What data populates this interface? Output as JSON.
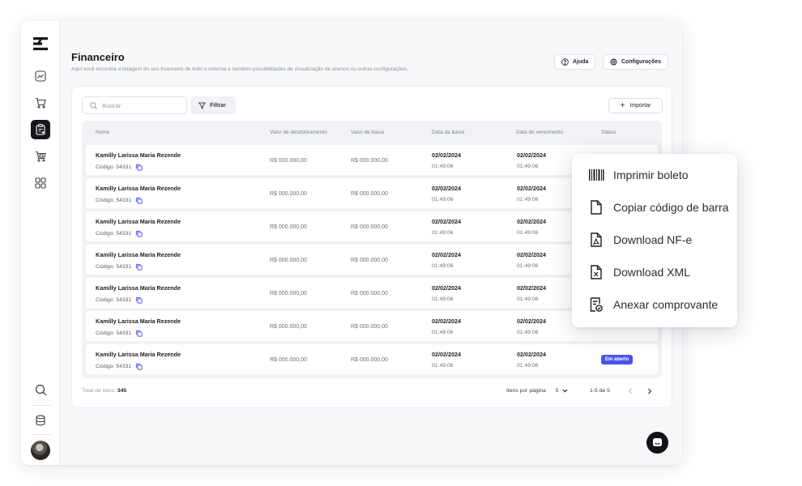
{
  "header": {
    "title": "Financeiro",
    "subtitle": "Aqui você encontra a listagem do seu financeiro de todo o sistema e também possibilidades de visualização de anexos ou outras configurações.",
    "help_label": "Ajuda",
    "settings_label": "Configurações"
  },
  "toolbar": {
    "search_placeholder": "Buscar",
    "filter_label": "Filtrar",
    "import_label": "Importar"
  },
  "table": {
    "columns": [
      "Nome",
      "Valor de desdobramento",
      "Valor de baixa",
      "Data da baixa",
      "Data do vencimento",
      "Status"
    ],
    "rows": [
      {
        "name": "Kamilly Larissa Maria Rezende",
        "code": "Código: 54331",
        "split_value": "R$ 000.000,00",
        "paid_value": "R$ 000.000,00",
        "paid_date": "02/02/2024",
        "paid_time": "01:49:06",
        "due_date": "02/02/2024",
        "due_time": "01:49:06",
        "status": ""
      },
      {
        "name": "Kamilly Larissa Maria Rezende",
        "code": "Código: 54331",
        "split_value": "R$ 000.000,00",
        "paid_value": "R$ 000.000,00",
        "paid_date": "02/02/2024",
        "paid_time": "01:49:06",
        "due_date": "02/02/2024",
        "due_time": "01:49:06",
        "status": ""
      },
      {
        "name": "Kamilly Larissa Maria Rezende",
        "code": "Código: 54331",
        "split_value": "R$ 000.000,00",
        "paid_value": "R$ 000.000,00",
        "paid_date": "02/02/2024",
        "paid_time": "01:49:06",
        "due_date": "02/02/2024",
        "due_time": "01:49:06",
        "status": ""
      },
      {
        "name": "Kamilly Larissa Maria Rezende",
        "code": "Código: 54331",
        "split_value": "R$ 000.000,00",
        "paid_value": "R$ 000.000,00",
        "paid_date": "02/02/2024",
        "paid_time": "01:49:06",
        "due_date": "02/02/2024",
        "due_time": "01:49:06",
        "status": ""
      },
      {
        "name": "Kamilly Larissa Maria Rezende",
        "code": "Código: 54331",
        "split_value": "R$ 000.000,00",
        "paid_value": "R$ 000.000,00",
        "paid_date": "02/02/2024",
        "paid_time": "01:49:06",
        "due_date": "02/02/2024",
        "due_time": "01:49:06",
        "status": ""
      },
      {
        "name": "Kamilly Larissa Maria Rezende",
        "code": "Código: 54331",
        "split_value": "R$ 000.000,00",
        "paid_value": "R$ 000.000,00",
        "paid_date": "02/02/2024",
        "paid_time": "01:49:06",
        "due_date": "02/02/2024",
        "due_time": "01:49:06",
        "status": ""
      },
      {
        "name": "Kamilly Larissa Maria Rezende",
        "code": "Código: 54331",
        "split_value": "R$ 000.000,00",
        "paid_value": "R$ 000.000,00",
        "paid_date": "02/02/2024",
        "paid_time": "01:49:06",
        "due_date": "02/02/2024",
        "due_time": "01:49:06",
        "status": "Em aberto"
      }
    ]
  },
  "footer": {
    "total_label": "Total de itens:",
    "total_value": "345",
    "per_page_label": "Itens por página",
    "per_page_value": "5",
    "range_label": "1-5 de 5"
  },
  "context_menu": {
    "items": [
      "Imprimir boleto",
      "Copiar código de barra",
      "Download NF-e",
      "Download XML",
      "Anexar comprovante"
    ]
  },
  "colors": {
    "accent": "#4a55e8",
    "sidebar_active": "#16171b"
  }
}
